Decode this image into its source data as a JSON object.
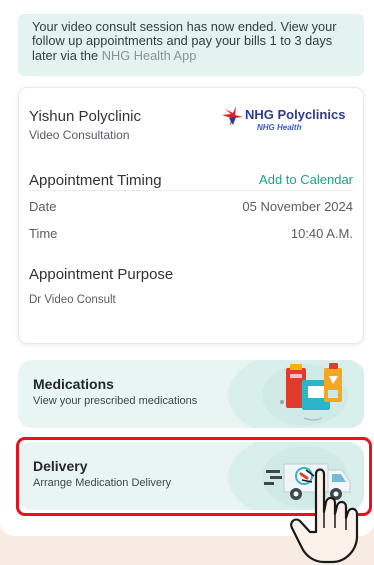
{
  "banner": {
    "text_before": "Your video consult session has now ended. View your follow up appointments and pay your bills 1 to 3 days later via the ",
    "app_name": "NHG Health App"
  },
  "appointment": {
    "clinic_name": "Yishun Polyclinic",
    "consult_type": "Video Consultation",
    "logo_text": "NHG Polyclinics",
    "logo_subtext": "NHG Health",
    "timing_title": "Appointment Timing",
    "add_calendar_label": "Add to Calendar",
    "date_label": "Date",
    "date_value": "05 November 2024",
    "time_label": "Time",
    "time_value": "10:40 A.M.",
    "purpose_title": "Appointment Purpose",
    "purpose_value": "Dr Video Consult"
  },
  "medications": {
    "title": "Medications",
    "subtitle": "View your prescribed medications",
    "icon": "medication-boxes-icon"
  },
  "delivery": {
    "title": "Delivery",
    "subtitle": "Arrange Medication Delivery",
    "icon": "delivery-van-icon",
    "highlight_color": "#e5131f"
  },
  "colors": {
    "accent": "#1fa37e",
    "banner_bg": "#e3f4f0",
    "tile_bg": "#e9f5f3",
    "page_bg": "#f8ebe3"
  }
}
